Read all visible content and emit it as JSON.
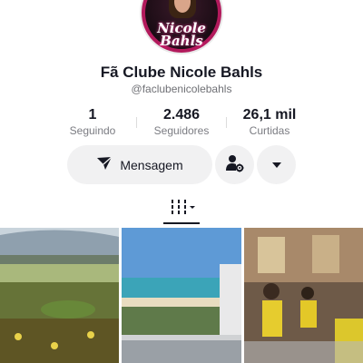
{
  "profile": {
    "avatar_alt": "Nicole Bahls",
    "avatar_logo_line1": "Nicole",
    "avatar_logo_line2": "Bahls",
    "name": "Fã Clube Nicole Bahls",
    "handle": "@faclubenicolebahls"
  },
  "stats": [
    {
      "value": "1",
      "label": "Seguindo"
    },
    {
      "value": "2.486",
      "label": "Seguidores"
    },
    {
      "value": "26,1 mil",
      "label": "Curtidas"
    }
  ],
  "actions": {
    "message_label": "Mensagem",
    "message_icon": "send-icon",
    "friends_icon": "person-gear-icon",
    "more_icon": "chevron-down-icon"
  },
  "tabs": {
    "active_icon": "grid-icon"
  },
  "colors": {
    "text": "#161823",
    "secondary_text": "#7b7c82",
    "button_bg": "#f1f1f2"
  }
}
